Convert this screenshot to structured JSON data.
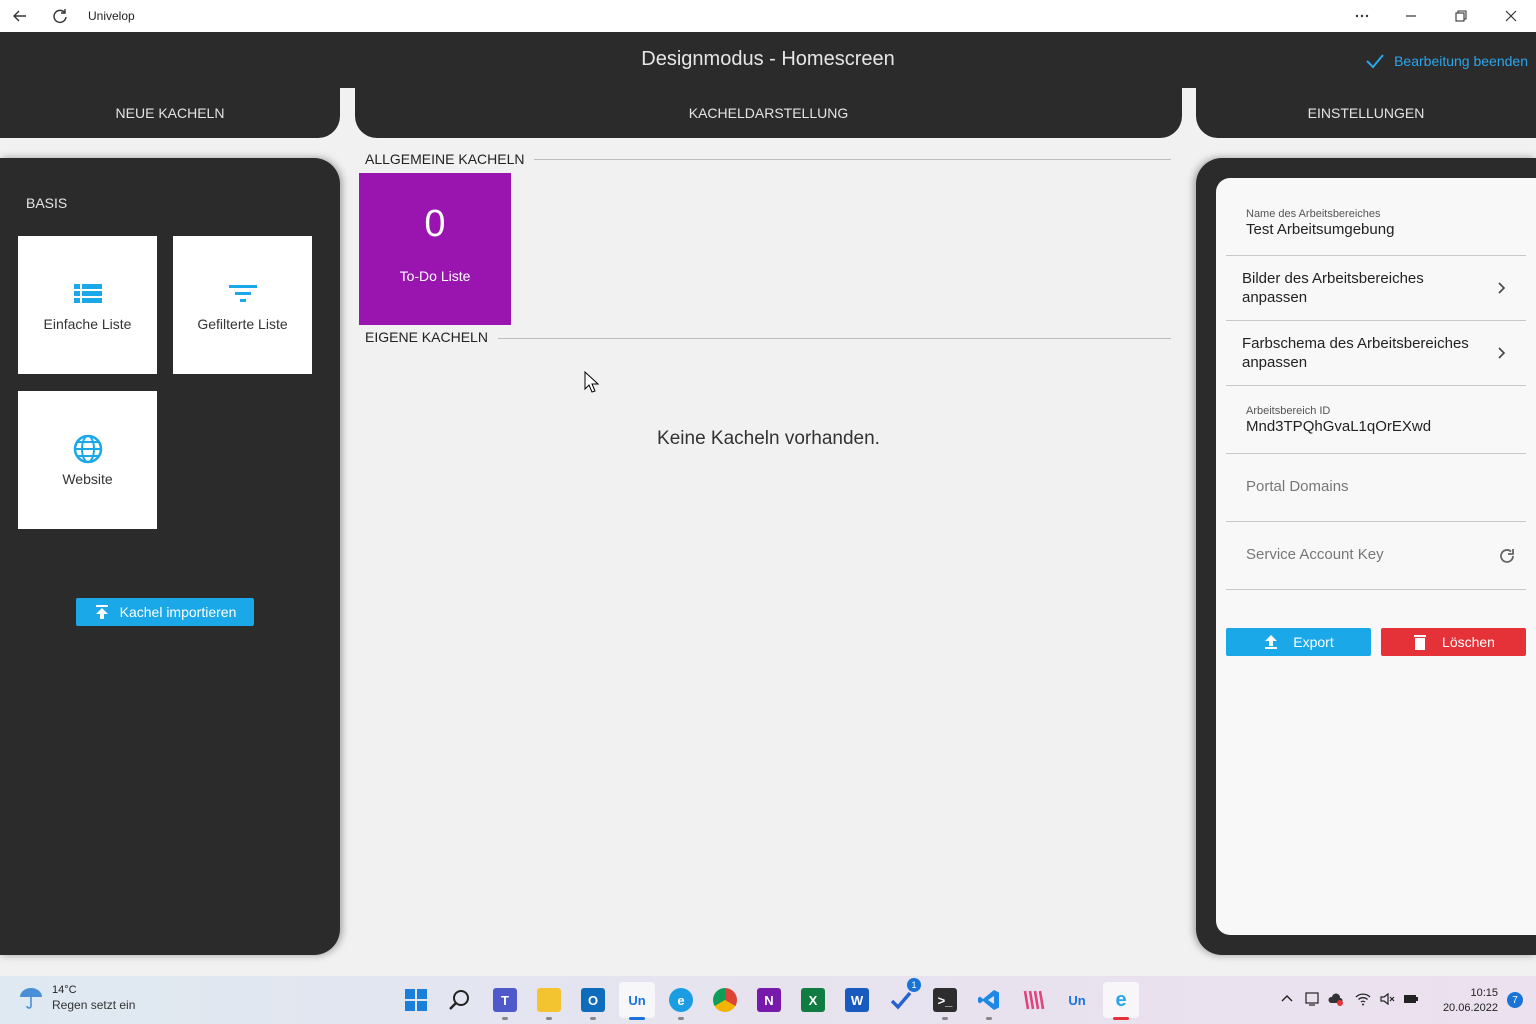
{
  "window": {
    "title": "Univelop",
    "back_icon": "back-arrow-icon",
    "refresh_icon": "refresh-icon",
    "more_icon": "more-dots-icon"
  },
  "header": {
    "title": "Designmodus - Homescreen",
    "finish_label": "Bearbeitung beenden"
  },
  "tabs": {
    "new_tiles": "NEUE KACHELN",
    "tile_display": "KACHELDARSTELLUNG",
    "settings": "EINSTELLUNGEN"
  },
  "left_panel": {
    "section": "BASIS",
    "tiles": [
      {
        "label": "Einfache Liste",
        "icon": "list-icon"
      },
      {
        "label": "Gefilterte Liste",
        "icon": "filter-icon"
      },
      {
        "label": "Website",
        "icon": "globe-icon"
      }
    ],
    "import_label": "Kachel importieren"
  },
  "center": {
    "general_heading": "ALLGEMEINE KACHELN",
    "todo_count": "0",
    "todo_label": "To-Do Liste",
    "own_heading": "EIGENE KACHELN",
    "empty_message": "Keine Kacheln vorhanden."
  },
  "settings": {
    "workspace_name_label": "Name des Arbeitsbereiches",
    "workspace_name_value": "Test Arbeitsumgebung",
    "images_link": "Bilder des Arbeitsbereiches anpassen",
    "color_link": "Farbschema des Arbeitsbereiches anpassen",
    "workspace_id_label": "Arbeitsbereich ID",
    "workspace_id_value": "Mnd3TPQhGvaL1qOrEXwd",
    "portal_domains_placeholder": "Portal Domains",
    "service_key_placeholder": "Service Account Key",
    "export_label": "Export",
    "delete_label": "Löschen"
  },
  "colors": {
    "accent": "#1ba8e8",
    "danger": "#e53239",
    "tile_purple": "#9a14b0",
    "dark_panel": "#2b2b2b"
  },
  "taskbar": {
    "temperature": "14°C",
    "weather_text": "Regen setzt ein",
    "time": "10:15",
    "date": "20.06.2022",
    "notifications": "7",
    "todo_badge": "1"
  }
}
